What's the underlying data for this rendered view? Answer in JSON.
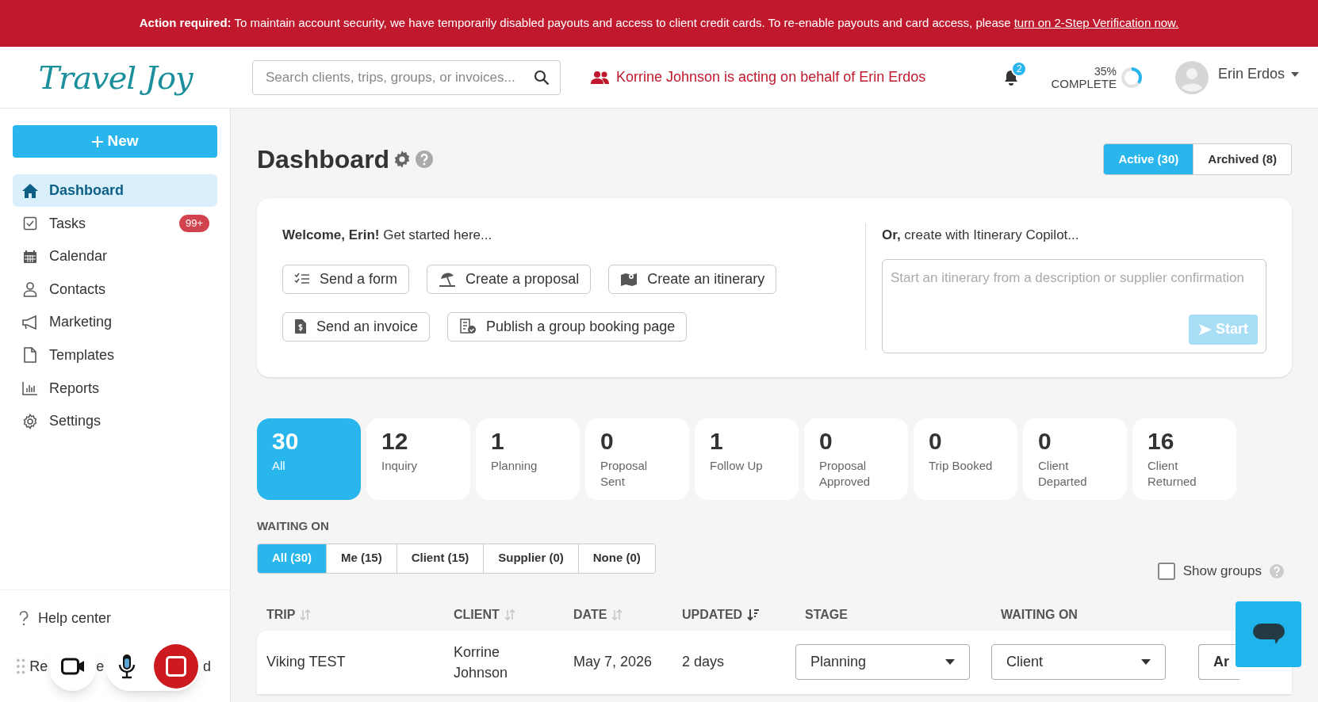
{
  "banner": {
    "text": "**Action required:** To maintain account security, we have temporarily disabled payouts and access to client credit cards. To re-enable payouts and card access, please",
    "link": "turn on 2-Step Verification now."
  },
  "header": {
    "logo": "Travel Joy",
    "search": {
      "placeholder": "Search clients, trips, groups, or invoices..."
    },
    "acting_notice": "Korrine Johnson is acting on behalf of Erin Erdos",
    "notifications": "2",
    "progress": {
      "percent": "35%",
      "label": "COMPLETE",
      "level": 0.35
    },
    "user": "Erin Erdos"
  },
  "sidebar": {
    "new_button": "New",
    "items": [
      {
        "label": "Dashboard",
        "selected": true
      },
      {
        "label": "Tasks",
        "selected": false,
        "badge": "99+"
      },
      {
        "label": "Calendar",
        "selected": false
      },
      {
        "label": "Contacts",
        "selected": false
      },
      {
        "label": "Marketing",
        "selected": false
      },
      {
        "label": "Templates",
        "selected": false
      },
      {
        "label": "Reports",
        "selected": false
      },
      {
        "label": "Settings",
        "selected": false
      }
    ],
    "help": "Help center",
    "footer_fragments": [
      "Re",
      "e",
      "d"
    ]
  },
  "page": {
    "title": "Dashboard",
    "view_tabs": [
      {
        "label": "Active (30)",
        "selected": true
      },
      {
        "label": "Archived (8)",
        "selected": false
      }
    ]
  },
  "welcome": {
    "greeting": "**Welcome, Erin!** Get started here...",
    "actions": [
      "Send a form",
      "Create a proposal",
      "Create an itinerary",
      "Send an invoice",
      "Publish a group booking page"
    ],
    "copilot_title": "**Or,** create with Itinerary Copilot...",
    "copilot_placeholder": "Start an itinerary from a description or supplier confirmation",
    "start_button": "Start"
  },
  "stages": [
    {
      "count": "30",
      "label": "All",
      "selected": true
    },
    {
      "count": "12",
      "label": "Inquiry",
      "selected": false
    },
    {
      "count": "1",
      "label": "Planning",
      "selected": false
    },
    {
      "count": "0",
      "label": "Proposal Sent",
      "selected": false
    },
    {
      "count": "1",
      "label": "Follow Up",
      "selected": false
    },
    {
      "count": "0",
      "label": "Proposal Approved",
      "selected": false
    },
    {
      "count": "0",
      "label": "Trip Booked",
      "selected": false
    },
    {
      "count": "0",
      "label": "Client Departed",
      "selected": false
    },
    {
      "count": "16",
      "label": "Client Returned",
      "selected": false
    }
  ],
  "waiting_on": {
    "title": "WAITING ON",
    "filters": [
      {
        "label": "All (30)",
        "selected": true
      },
      {
        "label": "Me (15)",
        "selected": false
      },
      {
        "label": "Client (15)",
        "selected": false
      },
      {
        "label": "Supplier (0)",
        "selected": false
      },
      {
        "label": "None (0)",
        "selected": false
      }
    ],
    "show_groups": {
      "label": "Show groups",
      "checked": false
    }
  },
  "table": {
    "columns": [
      {
        "label": "TRIP",
        "kind": "sortable"
      },
      {
        "label": "CLIENT",
        "kind": "sortable"
      },
      {
        "label": "DATE",
        "kind": "sortable"
      },
      {
        "label": "UPDATED",
        "kind": "sorted"
      },
      {
        "label": "STAGE",
        "kind": "plain"
      },
      {
        "label": "WAITING ON",
        "kind": "plain"
      }
    ],
    "rows": [
      {
        "trip": "Viking TEST",
        "client": "Korrine Johnson",
        "date": "May 7, 2026",
        "updated": "2 days",
        "stage": "Planning",
        "waiting_on": "Client",
        "action": "Ar"
      }
    ]
  }
}
